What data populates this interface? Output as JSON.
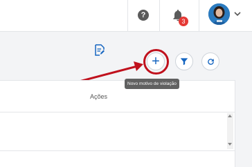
{
  "header": {
    "help_icon": "help-circle-icon",
    "help_label": "?",
    "notifications_icon": "bell-icon",
    "notification_count": "3",
    "avatar_icon": "user-avatar",
    "menu_icon": "chevron-down-icon"
  },
  "toolbar": {
    "add_label": "+",
    "add_tooltip": "Novo motivo de violação",
    "filter_icon": "filter-icon",
    "refresh_icon": "refresh-icon"
  },
  "table": {
    "columns": [
      "Ações"
    ],
    "rows": [
      {
        "action_icon": "edit-document-icon"
      }
    ]
  },
  "colors": {
    "accent": "#1565c0",
    "highlight": "#c0111d",
    "badge": "#e53935",
    "tooltip_bg": "#616161"
  }
}
